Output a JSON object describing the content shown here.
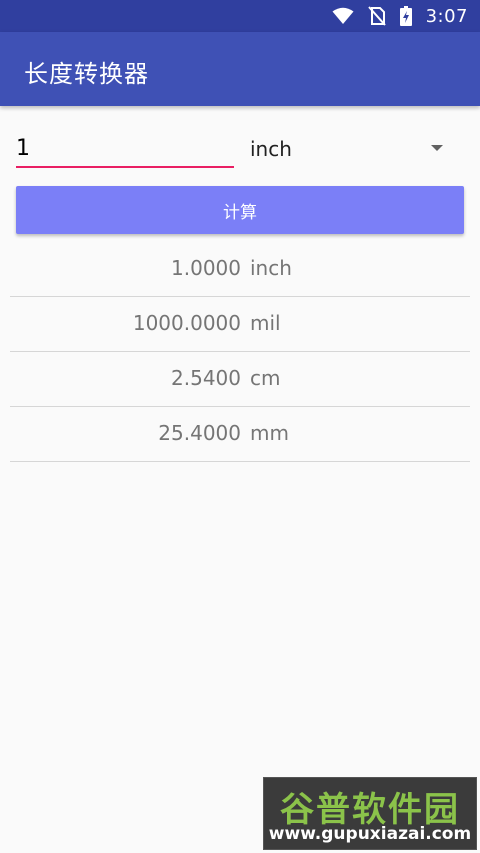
{
  "status_bar": {
    "time": "3:07",
    "icons": [
      "wifi-icon",
      "no-sim-icon",
      "battery-charging-icon"
    ]
  },
  "app_bar": {
    "title": "长度转换器"
  },
  "input": {
    "value": "1"
  },
  "unit_select": {
    "selected": "inch"
  },
  "calc_button": {
    "label": "计算"
  },
  "results": [
    {
      "value": "1.0000",
      "unit": "inch"
    },
    {
      "value": "1000.0000",
      "unit": "mil"
    },
    {
      "value": "2.5400",
      "unit": "cm"
    },
    {
      "value": "25.4000",
      "unit": "mm"
    }
  ],
  "watermark": {
    "title": "谷普软件园",
    "url": "www.gupuxiazai.com"
  },
  "colors": {
    "status_bar": "#303f9f",
    "app_bar": "#3f51b5",
    "accent": "#e91e63",
    "button": "#7b7ff7"
  }
}
